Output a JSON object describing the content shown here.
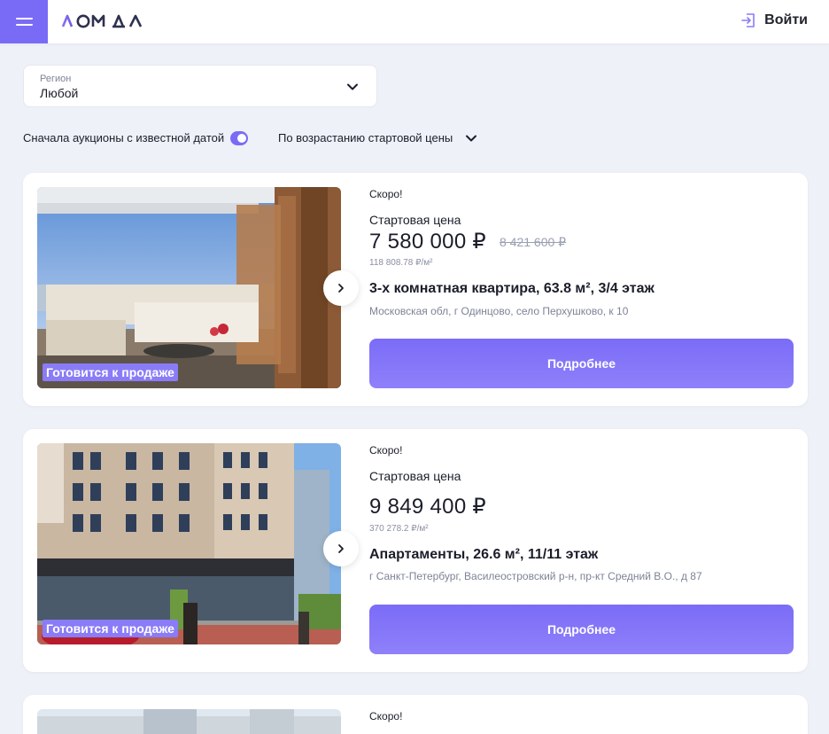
{
  "header": {
    "logo_text": "ДОМ ДА",
    "login_label": "Войти"
  },
  "region": {
    "label": "Регион",
    "value": "Любой"
  },
  "filters": {
    "toggle_label": "Сначала аукционы с известной датой",
    "toggle_on": true,
    "sort_label": "По возрастанию стартовой цены"
  },
  "colors": {
    "accent": "#7a6bf6",
    "background": "#eef1f8"
  },
  "listings": [
    {
      "status": "Скоро!",
      "price_label": "Стартовая цена",
      "price": "7 580 000 ₽",
      "old_price": "8 421 600 ₽",
      "price_per_m2": "118 808.78 ₽/м²",
      "title": "3-х комнатная квартира, 63.8 м², 3/4 этаж",
      "address": "Московская обл, г Одинцово, село Перхушково, к 10",
      "badge": "Готовится к продаже",
      "button": "Подробнее"
    },
    {
      "status": "Скоро!",
      "price_label": "Стартовая цена",
      "price": "9 849 400 ₽",
      "price_per_m2": "370 278.2 ₽/м²",
      "title": "Апартаменты, 26.6 м², 11/11 этаж",
      "address": "г Санкт-Петербург, Василеостровский р-н, пр-кт Средний В.О., д 87",
      "badge": "Готовится к продаже",
      "button": "Подробнее"
    },
    {
      "status": "Скоро!"
    }
  ]
}
